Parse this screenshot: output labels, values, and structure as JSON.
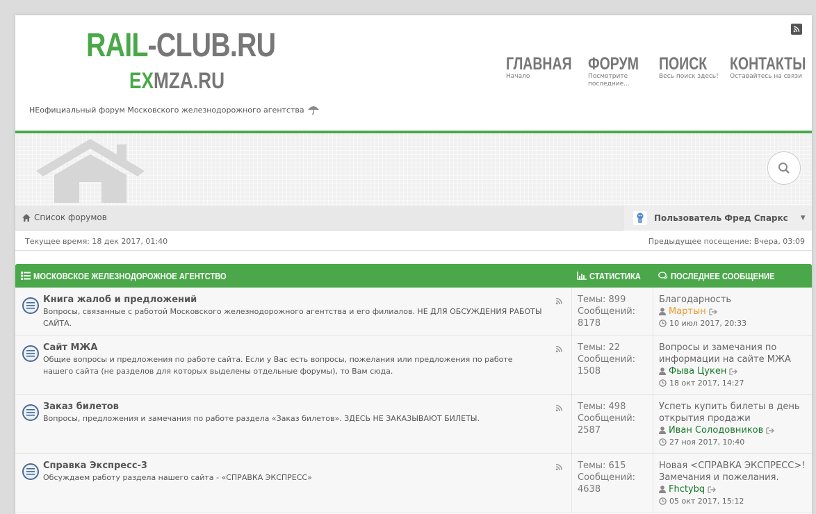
{
  "logo": {
    "line1_green": "RAIL",
    "line1_rest": "-CLUB.RU",
    "line2_green": "EX",
    "line2_rest": "MZA.RU",
    "tagline": "НЕофициальный форум Московского железнодорожного агентства"
  },
  "topnav": [
    {
      "label": "ГЛАВНАЯ",
      "sub": "Начало",
      "icon": "home-icon"
    },
    {
      "label": "ФОРУМ",
      "sub": "Посмотрите последние...",
      "icon": "comments-icon"
    },
    {
      "label": "ПОИСК",
      "sub": "Весь поиск здесь!",
      "icon": "search-icon"
    },
    {
      "label": "КОНТАКТЫ",
      "sub": "Оставайтесь на связи",
      "icon": "rocket-icon"
    }
  ],
  "navbar": {
    "breadcrumb": "Список форумов",
    "user": "Пользователь Фред Спаркс"
  },
  "info": {
    "current_time": "Текущее время: 18 дек 2017, 01:40",
    "last_visit": "Предыдущее посещение: Вчера, 03:09"
  },
  "forum_header": {
    "title": "МОСКОВСКОЕ ЖЕЛЕЗНОДОРОЖНОЕ АГЕНТСТВО",
    "stats": "СТАТИСТИКА",
    "last_post": "ПОСЛЕДНЕЕ СООБЩЕНИЕ"
  },
  "forums": [
    {
      "title": "Книга жалоб и предложений",
      "desc": "Вопросы, связанные с работой Московского железнодорожного агентства и его филиалов. НЕ ДЛЯ ОБСУЖДЕНИЯ РАБОТЫ САЙТА.",
      "topics": "Темы: 899",
      "posts_label": "Сообщений:",
      "posts": "8178",
      "last_title": "Благодарность",
      "last_user": "Мартын",
      "last_user_color": "#e69b2b",
      "last_date": "10 июл 2017, 20:33"
    },
    {
      "title": "Сайт МЖА",
      "desc": "Общие вопросы и предложения по работе сайта. Если у Вас есть вопросы, пожелания или предложения по работе нашего сайта (не разделов для которых выделены отдельные форумы), то Вам сюда.",
      "topics": "Темы: 22",
      "posts_label": "Сообщений:",
      "posts": "1508",
      "last_title": "Вопросы и замечания по информации на сайте МЖА",
      "last_user": "Фыва Цукен",
      "last_user_color": "#1a7a2a",
      "last_date": "18 окт 2017, 14:27"
    },
    {
      "title": "Заказ билетов",
      "desc": "Вопросы, предложения и замечания по работе раздела «Заказ билетов». ЗДЕСЬ НЕ ЗАКАЗЫВАЮТ БИЛЕТЫ.",
      "topics": "Темы: 498",
      "posts_label": "Сообщений:",
      "posts": "2587",
      "last_title": "Успеть купить билеты в день открытия продажи",
      "last_user": "Иван Солодовников",
      "last_user_color": "#1a7a2a",
      "last_date": "27 ноя 2017, 10:40"
    },
    {
      "title": "Справка Экспресс-3",
      "desc": "Обсуждаем работу раздела нашего сайта - «СПРАВКА ЭКСПРЕСС»",
      "topics": "Темы: 615",
      "posts_label": "Сообщений:",
      "posts": "4638",
      "last_title": "Новая <СПРАВКА ЭКСПРЕСС>! Замечания и пожелания.",
      "last_user": "Fhctybq",
      "last_user_color": "#1a7a2a",
      "last_date": "05 окт 2017, 15:12"
    }
  ],
  "colors": {
    "accent": "#4aa84a",
    "text": "#555555"
  }
}
